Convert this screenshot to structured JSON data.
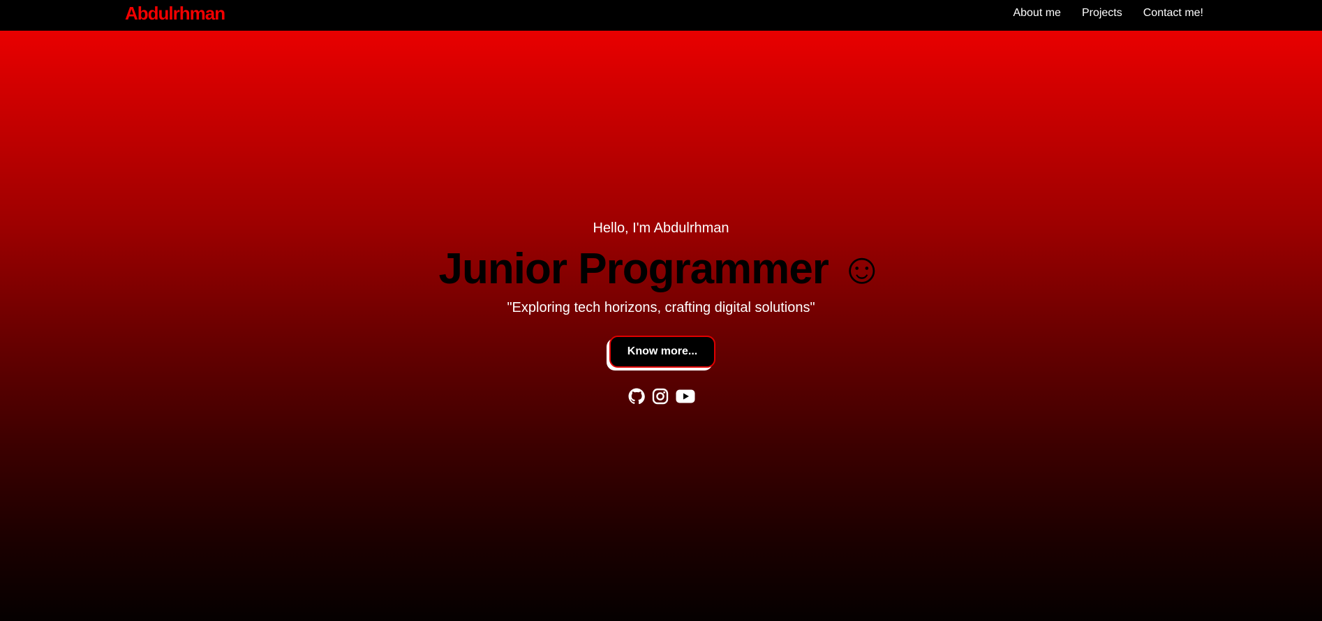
{
  "navbar": {
    "brand": "Abdulrhman",
    "links": [
      "About me",
      "Projects",
      "Contact me!"
    ]
  },
  "hero": {
    "greeting": "Hello, I'm Abdulrhman",
    "headline": "Junior Programmer ☺",
    "tagline": "\"Exploring tech horizons, crafting digital solutions\"",
    "cta_label": "Know more..."
  },
  "social": [
    {
      "name": "github-icon"
    },
    {
      "name": "instagram-icon"
    },
    {
      "name": "youtube-icon"
    }
  ],
  "colors": {
    "brand": "#f10000",
    "navbar_bg": "#000000",
    "gradient_top": "#f60000",
    "gradient_bottom": "#050000"
  }
}
